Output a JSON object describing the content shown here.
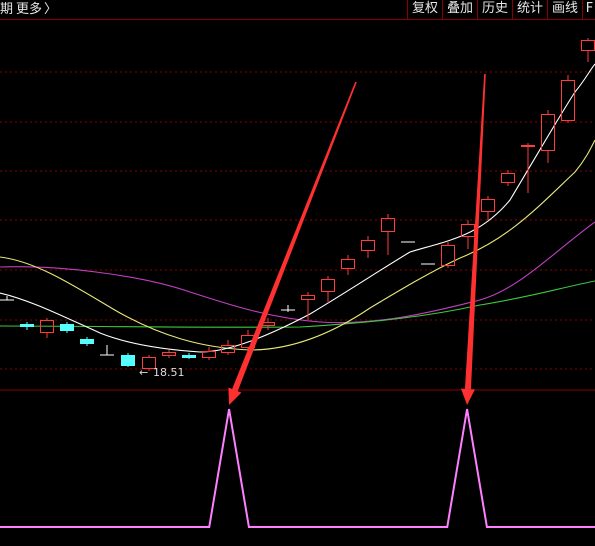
{
  "toolbar": {
    "period_label": "期",
    "more_label": "更多",
    "more_chevron": "〉",
    "buttons": [
      "复权",
      "叠加",
      "历史",
      "统计",
      "画线",
      "F"
    ]
  },
  "price_panel": {
    "low_annotation": "18.51",
    "low_marker_icon": "arrow-left-icon"
  },
  "colors": {
    "background": "#000000",
    "grid": "#8a0000",
    "candle_up": "#ff3b3b",
    "candle_down": "#54ffff",
    "flat_tick": "#ffffff",
    "ma_white": "#ffffff",
    "ma_yellow": "#e8e878",
    "ma_magenta": "#c040c0",
    "ma_green": "#3ec83e",
    "signal": "#ff80ff",
    "arrow": "#ff3030"
  },
  "chart_data": {
    "type": "candlestick",
    "series": [
      {
        "name": "",
        "kind": "candlestick"
      },
      {
        "name": "",
        "kind": "moving-average"
      },
      {
        "name": "",
        "kind": "moving-average"
      },
      {
        "name": "",
        "kind": "moving-average"
      },
      {
        "name": "",
        "kind": "moving-average"
      }
    ],
    "indicator": {
      "type": "line",
      "values": [
        0,
        0,
        0,
        0,
        0,
        0,
        0,
        0,
        0,
        0,
        0,
        1,
        0,
        0,
        0,
        0,
        0,
        0,
        0,
        0,
        0,
        0,
        0,
        1,
        0,
        0,
        0,
        0,
        0,
        0
      ],
      "signal_bars": [
        11,
        23
      ]
    },
    "annotations": [
      "18.51"
    ]
  }
}
